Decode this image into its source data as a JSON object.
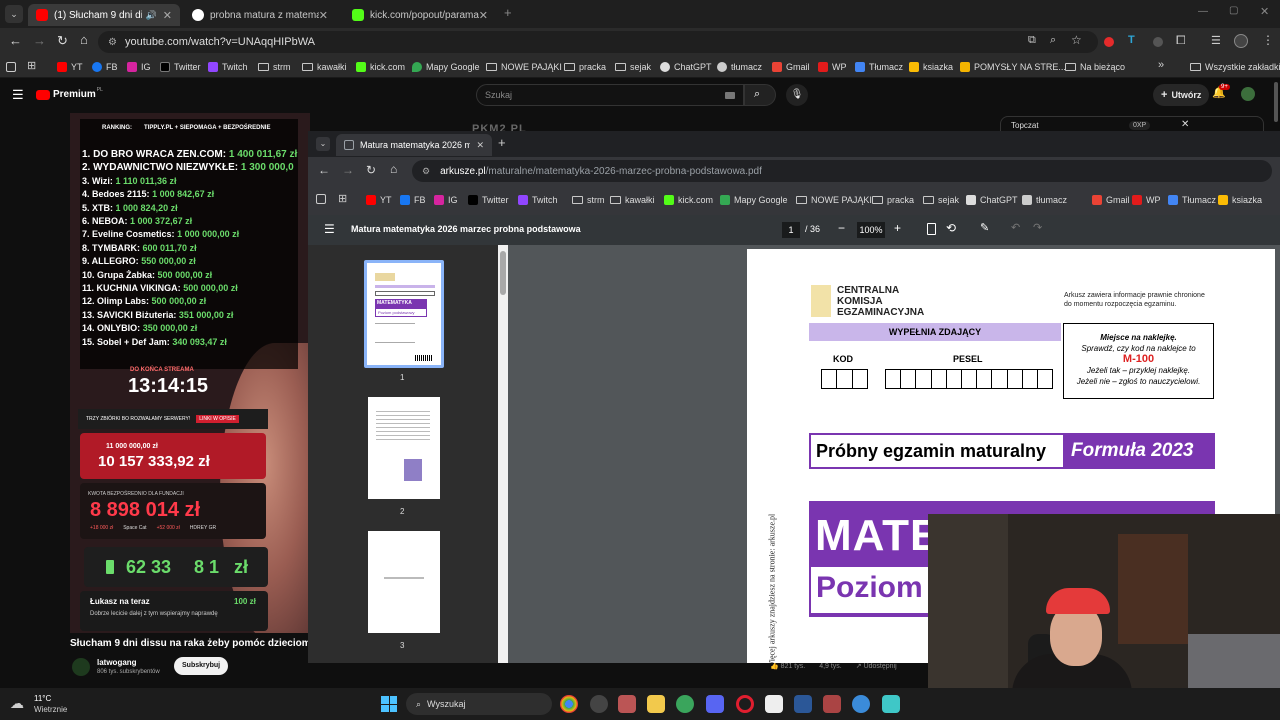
{
  "browser": {
    "tabs": [
      {
        "title": "(1) Słucham 9 dni dissu na r",
        "active": true
      },
      {
        "title": "probna matura z matematyki 2(",
        "active": false
      },
      {
        "title": "kick.com/popout/paramaxil/ch",
        "active": false
      }
    ],
    "url": "youtube.com/watch?v=UNAqqHIPbWA",
    "bookmarks": [
      "YT",
      "FB",
      "IG",
      "Twitter",
      "Twitch",
      "strm",
      "kawałki",
      "kick.com",
      "Mapy Google",
      "NOWE PAJĄKI",
      "pracka",
      "sejak",
      "ChatGPT",
      "tłumacz",
      "Gmail",
      "WP",
      "Tłumacz",
      "ksiazka",
      "POMYSŁY NA STRE...",
      "Na bieżąco"
    ],
    "all_bookmarks": "Wszystkie zakładki"
  },
  "youtube": {
    "logo_text": "Premium",
    "logo_sup": "PL",
    "search_placeholder": "Szukaj",
    "create_label": "Utwórz",
    "notif_count": "9+",
    "video_title": "Słucham 9 dni dissu na raka żeby pomóc dzieciom z",
    "channel_name": "latwogang",
    "subscribers": "806 tys. subskrybentów",
    "subscribe_label": "Subskrybuj",
    "stats": [
      "821 tys.",
      "4,9 tys.",
      "Udostępnij"
    ],
    "chat_dropdown": "Topczat",
    "chat_xp": "0XP"
  },
  "stream": {
    "header": "RANKING:",
    "header_right": "TIPPLY.PL + SIEPOMAGA + BEZPOŚREDNIE",
    "ranking": [
      {
        "name": "1. DO BRO WRACA ZEN.COM:",
        "amount": "1 400 011,67 zł"
      },
      {
        "name": "2. WYDAWNICTWO NIEZWYKŁE:",
        "amount": "1 300 000,0"
      },
      {
        "name": "3. Wizi:",
        "amount": "1 110 011,36 zł"
      },
      {
        "name": "4. Bedoes 2115:",
        "amount": "1 000 842,67 zł"
      },
      {
        "name": "5. XTB:",
        "amount": "1 000 824,20 zł"
      },
      {
        "name": "6. NEBOA:",
        "amount": "1 000 372,67 zł"
      },
      {
        "name": "7. Eveline Cosmetics:",
        "amount": "1 000 000,00 zł"
      },
      {
        "name": "8. TYMBARK:",
        "amount": "600 011,70 zł"
      },
      {
        "name": "9. ALLEGRO:",
        "amount": "550 000,00 zł"
      },
      {
        "name": "10. Grupa Żabka:",
        "amount": "500 000,00 zł"
      },
      {
        "name": "11. KUCHNIA VIKINGA:",
        "amount": "500 000,00 zł"
      },
      {
        "name": "12. Olimp Labs:",
        "amount": "500 000,00 zł"
      },
      {
        "name": "13. SAVICKI Biżuteria:",
        "amount": "351 000,00 zł"
      },
      {
        "name": "14. ONLYBIO:",
        "amount": "350 000,00 zł"
      },
      {
        "name": "15. Sobel + Def Jam:",
        "amount": "340 093,47 zł"
      }
    ],
    "countdown_label": "DO KOŃCA STREAMA",
    "countdown": "13:14:15",
    "banner": "TRZY ZBIÓRKI BO ROZWALAMY SERWERY!",
    "banner_tag": "LINKI W OPISIE",
    "goal_small": "11 000 000,00 zł",
    "goal_main": "10 157 333,92 zł",
    "direct_label": "KWOTA BEZPOŚREDNIO DLA FUNDACJI",
    "direct_amount": "8 898 014 zł",
    "ticker": [
      "+18 000 zł",
      "Space Cat",
      "+52 000 zł",
      "HDREY GR"
    ],
    "counter": "62 33",
    "counter_tail": "8 1",
    "counter_unit": "zł",
    "donor_name": "Łukasz na teraz",
    "donor_amount": "100 zł",
    "donor_msg": "Dobrze lecicie dalej z tym wspierajmy naprawdę",
    "overlay_title": "PKM2 PL"
  },
  "nested": {
    "tab_title": "Matura matematyka 2026 marz",
    "url_domain": "arkusze.pl",
    "url_path": "/maturalne/matematyka-2026-marzec-probna-podstawowa.pdf",
    "bookmarks": [
      "YT",
      "FB",
      "IG",
      "Twitter",
      "Twitch",
      "strm",
      "kawałki",
      "kick.com",
      "Mapy Google",
      "NOWE PAJĄKI",
      "pracka",
      "sejak",
      "ChatGPT",
      "tłumacz",
      "Gmail",
      "WP",
      "Tłumacz",
      "ksiazka"
    ]
  },
  "pdf": {
    "title": "Matura matematyka 2026 marzec probna podstawowa",
    "page_current": "1",
    "page_total": "/ 36",
    "zoom": "100%",
    "thumb_labels": [
      "1",
      "2",
      "3"
    ],
    "thumb1_subject": "MATEMATYKA",
    "thumb1_level": "Poziom podstawowy",
    "cke_lines": [
      "CENTRALNA",
      "KOMISJA",
      "EGZAMINACYJNA"
    ],
    "notice": "Arkusz zawiera informacje prawnie chronione do momentu rozpoczęcia egzaminu.",
    "fill_header": "WYPEŁNIA ZDAJĄCY",
    "kod": "KOD",
    "pesel": "PESEL",
    "sticker_title": "Miejsce na naklejkę.",
    "sticker_line1": "Sprawdź, czy kod na naklejce to",
    "sticker_code": "M-100",
    "sticker_line2": "Jeżeli tak – przyklej naklejkę.",
    "sticker_line3": "Jeżeli nie – zgłoś to nauczycielowi.",
    "exam_title": "Próbny egzamin maturalny",
    "formula": "Formuła 2023",
    "subject_big": "MATE",
    "level_big": "Poziom",
    "side_text": "Więcej arkuszy znajdziesz na stronie: arkusze.pl"
  },
  "taskbar": {
    "temp": "11°C",
    "weather": "Wietrznie",
    "search": "Wyszukaj"
  }
}
